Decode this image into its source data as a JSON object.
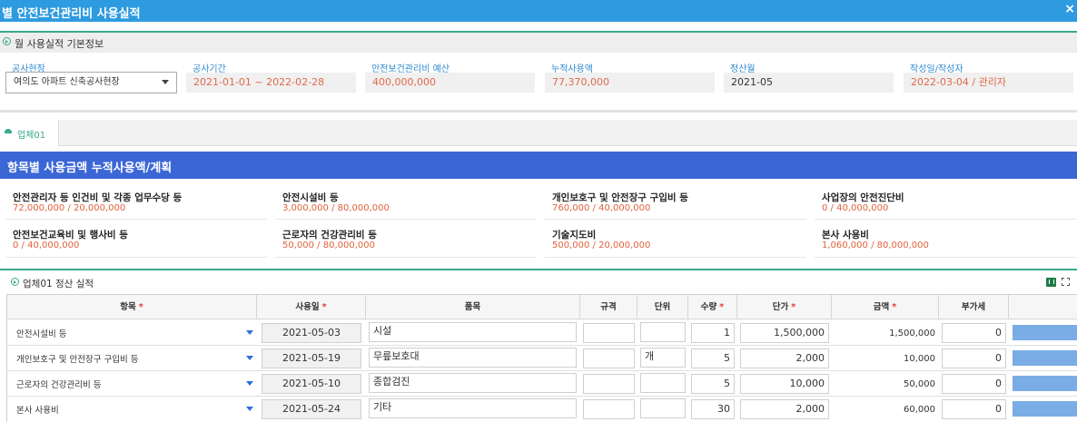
{
  "window": {
    "title": "별 안전보건관리비 사용실적",
    "close": "×"
  },
  "basic_info": {
    "header": "월 사용실적 기본정보",
    "site": {
      "label": "공사현장",
      "value": "여의도 아파트 신축공사현장"
    },
    "period": {
      "label": "공사기간",
      "value": "2021-01-01 ~ 2022-02-28"
    },
    "budget": {
      "label": "안전보건관리비 예산",
      "value": "400,000,000"
    },
    "cumulative": {
      "label": "누적사용액",
      "value": "77,370,000"
    },
    "settle_month": {
      "label": "정산월",
      "value": "2021-05"
    },
    "author": {
      "label": "작성일/작성자",
      "value": "2022-03-04 / 관리자"
    }
  },
  "tabs": [
    {
      "label": "업체01"
    }
  ],
  "summary": {
    "title": "항목별 사용금액 누적사용액/계획",
    "items": [
      {
        "name": "안전관리자 등 인건비 및 각종 업무수당 등",
        "value": "72,000,000 / 20,000,000"
      },
      {
        "name": "안전시설비 등",
        "value": "3,000,000 / 80,000,000"
      },
      {
        "name": "개인보호구 및 안전장구 구입비 등",
        "value": "760,000 / 40,000,000"
      },
      {
        "name": "사업장의 안전진단비",
        "value": "0 / 40,000,000"
      },
      {
        "name": "안전보건교육비 및 행사비 등",
        "value": "0 / 40,000,000"
      },
      {
        "name": "근로자의 건강관리비 등",
        "value": "50,000 / 80,000,000"
      },
      {
        "name": "기술지도비",
        "value": "500,000 / 20,000,000"
      },
      {
        "name": "본사 사용비",
        "value": "1,060,000 / 80,000,000"
      }
    ]
  },
  "settlement": {
    "header": "업체01 정산 실적",
    "required_mark": "*",
    "columns": {
      "item": "항목",
      "date": "사용일",
      "product": "품목",
      "spec": "규격",
      "unit": "단위",
      "qty": "수량",
      "price": "단가",
      "amount": "금액",
      "vat": "부가세"
    },
    "rows": [
      {
        "item": "안전시설비 등",
        "date": "2021-05-03",
        "product": "시설",
        "spec": "",
        "unit": "",
        "qty": "1",
        "price": "1,500,000",
        "amount": "1,500,000",
        "vat": "0"
      },
      {
        "item": "개인보호구 및 안전장구 구입비 등",
        "date": "2021-05-19",
        "product": "무릎보호대",
        "spec": "",
        "unit": "개",
        "qty": "5",
        "price": "2,000",
        "amount": "10,000",
        "vat": "0"
      },
      {
        "item": "근로자의 건강관리비 등",
        "date": "2021-05-10",
        "product": "종합검진",
        "spec": "",
        "unit": "",
        "qty": "5",
        "price": "10,000",
        "amount": "50,000",
        "vat": "0"
      },
      {
        "item": "본사 사용비",
        "date": "2021-05-24",
        "product": "기타",
        "spec": "",
        "unit": "",
        "qty": "30",
        "price": "2,000",
        "amount": "60,000",
        "vat": "0"
      }
    ]
  }
}
